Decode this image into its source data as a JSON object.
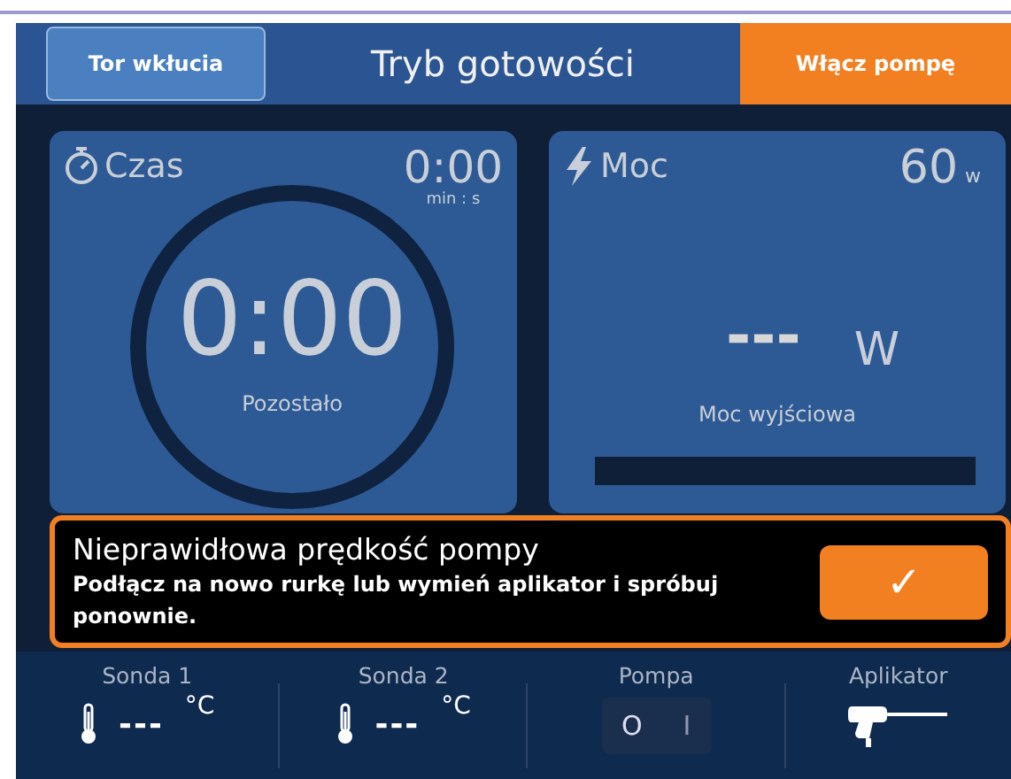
{
  "header": {
    "back_button": "Tor wkłucia",
    "title": "Tryb gotowości",
    "start_button": "Włącz pompę"
  },
  "time_card": {
    "label": "Czas",
    "set_value": "0:00",
    "set_unit": "min : s",
    "remaining": "0:00",
    "remaining_label": "Pozostało"
  },
  "power_card": {
    "label": "Moc",
    "set_value": "60",
    "set_unit": "w",
    "output_value": "---",
    "output_unit": "W",
    "output_label": "Moc wyjściowa",
    "level": 0
  },
  "alert": {
    "title": "Nieprawidłowa prędkość pompy",
    "message": "Podłącz na nowo rurkę lub wymień aplikator i spróbuj ponownie.",
    "confirm_button": "✓"
  },
  "status_bar": [
    {
      "kind": "probe",
      "label": "Sonda 1",
      "value": "---",
      "unit": "°C"
    },
    {
      "kind": "probe",
      "label": "Sonda 2",
      "value": "---",
      "unit": "°C"
    },
    {
      "kind": "pump",
      "label": "Pompa",
      "on": false,
      "off_mark": "O",
      "on_mark": "I"
    },
    {
      "kind": "applicator",
      "label": "Aplikator"
    }
  ]
}
